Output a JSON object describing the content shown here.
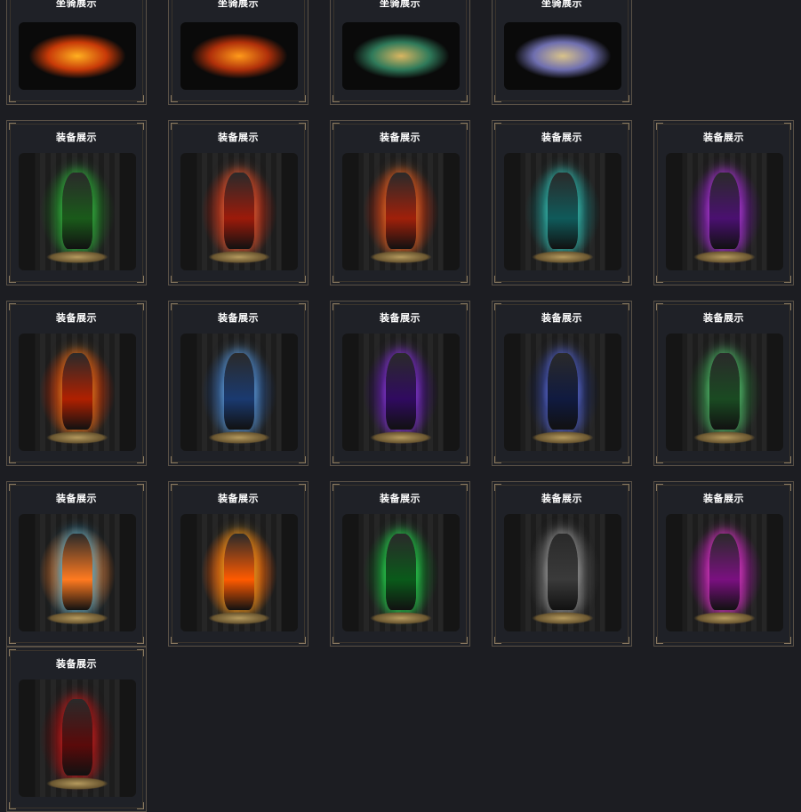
{
  "cards": [
    {
      "title": "坐骑展示",
      "image": "mount-fire-phoenix",
      "colors": [
        "#ffb020",
        "#c83a08"
      ]
    },
    {
      "title": "坐骑展示",
      "image": "mount-fire-beast",
      "colors": [
        "#ff9a1a",
        "#b0300a"
      ]
    },
    {
      "title": "坐骑展示",
      "image": "mount-jade-dragon",
      "colors": [
        "#d9b560",
        "#2f7a5a"
      ]
    },
    {
      "title": "坐骑展示",
      "image": "mount-silver-dragon",
      "colors": [
        "#d8c28a",
        "#6f6fb0"
      ]
    },
    {
      "title": "装备展示",
      "image": "armor-green-dragon",
      "colors": [
        "#38d048",
        "#1a5a1a"
      ]
    },
    {
      "title": "装备展示",
      "image": "armor-flame-hammer",
      "colors": [
        "#ff6a3a",
        "#9c1a0a"
      ]
    },
    {
      "title": "装备展示",
      "image": "armor-fire-blade",
      "colors": [
        "#ff7a2a",
        "#a0200a"
      ]
    },
    {
      "title": "装备展示",
      "image": "armor-teal-spirit",
      "colors": [
        "#40e0d0",
        "#0f5a5a"
      ]
    },
    {
      "title": "装备展示",
      "image": "armor-violet-swords",
      "colors": [
        "#d040ff",
        "#4a1070"
      ]
    },
    {
      "title": "装备展示",
      "image": "armor-inferno-demon",
      "colors": [
        "#ff8a20",
        "#b02000"
      ]
    },
    {
      "title": "装备展示",
      "image": "armor-ice-wings",
      "colors": [
        "#6fb8ff",
        "#1a3a70"
      ]
    },
    {
      "title": "装备展示",
      "image": "armor-purple-lance",
      "colors": [
        "#a040ff",
        "#300a60"
      ]
    },
    {
      "title": "装备展示",
      "image": "armor-shadow-blade",
      "colors": [
        "#6a7cff",
        "#101a40"
      ]
    },
    {
      "title": "装备展示",
      "image": "armor-jade-spear",
      "colors": [
        "#60e080",
        "#1a4a22"
      ]
    },
    {
      "title": "装备展示",
      "image": "armor-azure-trident",
      "colors": [
        "#40c8ff",
        "#ff7a20"
      ]
    },
    {
      "title": "装备展示",
      "image": "armor-golden-sage",
      "colors": [
        "#ffb020",
        "#ff5a00"
      ]
    },
    {
      "title": "装备展示",
      "image": "armor-emerald-storm",
      "colors": [
        "#30ff60",
        "#0a5a1a"
      ]
    },
    {
      "title": "装备展示",
      "image": "armor-silver-dragon-throne",
      "colors": [
        "#b8b8b8",
        "#3a3a3a"
      ]
    },
    {
      "title": "装备展示",
      "image": "armor-magenta-blaze",
      "colors": [
        "#ff40e0",
        "#7a1080"
      ]
    },
    {
      "title": "装备展示",
      "image": "armor-crimson",
      "colors": [
        "#e02020",
        "#5a0a0a"
      ]
    }
  ]
}
